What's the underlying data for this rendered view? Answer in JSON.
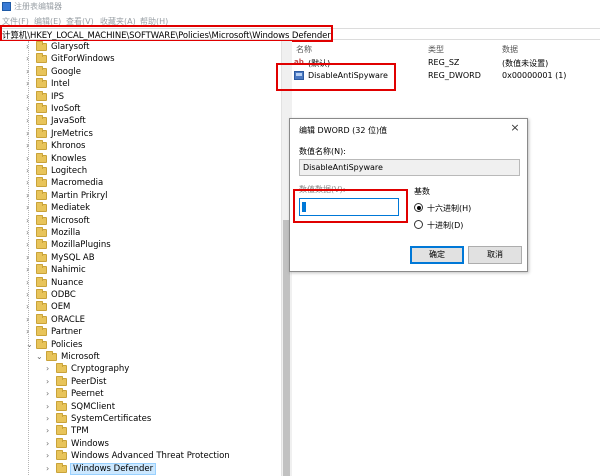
{
  "window": {
    "title": "注册表编辑器"
  },
  "menu": [
    "文件(F)",
    "编辑(E)",
    "查看(V)",
    "收藏夹(A)",
    "帮助(H)"
  ],
  "address": {
    "path": "计算机\\HKEY_LOCAL_MACHINE\\SOFTWARE\\Policies\\Microsoft\\Windows Defender"
  },
  "tree": {
    "items": [
      {
        "label": "Glarysoft",
        "level": 1
      },
      {
        "label": "GitForWindows",
        "level": 1
      },
      {
        "label": "Google",
        "level": 1
      },
      {
        "label": "Intel",
        "level": 1
      },
      {
        "label": "IPS",
        "level": 1
      },
      {
        "label": "IvoSoft",
        "level": 1
      },
      {
        "label": "JavaSoft",
        "level": 1
      },
      {
        "label": "JreMetrics",
        "level": 1
      },
      {
        "label": "Khronos",
        "level": 1
      },
      {
        "label": "Knowles",
        "level": 1
      },
      {
        "label": "Logitech",
        "level": 1
      },
      {
        "label": "Macromedia",
        "level": 1
      },
      {
        "label": "Martin Prikryl",
        "level": 1
      },
      {
        "label": "Mediatek",
        "level": 1
      },
      {
        "label": "Microsoft",
        "level": 1
      },
      {
        "label": "Mozilla",
        "level": 1
      },
      {
        "label": "MozillaPlugins",
        "level": 1
      },
      {
        "label": "MySQL AB",
        "level": 1
      },
      {
        "label": "Nahimic",
        "level": 1
      },
      {
        "label": "Nuance",
        "level": 1
      },
      {
        "label": "ODBC",
        "level": 1
      },
      {
        "label": "OEM",
        "level": 1
      },
      {
        "label": "ORACLE",
        "level": 1
      },
      {
        "label": "Partner",
        "level": 1
      },
      {
        "label": "Policies",
        "level": 1,
        "expanded": true
      },
      {
        "label": "Microsoft",
        "level": 2,
        "expanded": true
      },
      {
        "label": "Cryptography",
        "level": 3
      },
      {
        "label": "PeerDist",
        "level": 3
      },
      {
        "label": "Peernet",
        "level": 3
      },
      {
        "label": "SQMClient",
        "level": 3
      },
      {
        "label": "SystemCertificates",
        "level": 3
      },
      {
        "label": "TPM",
        "level": 3
      },
      {
        "label": "Windows",
        "level": 3
      },
      {
        "label": "Windows Advanced Threat Protection",
        "level": 3
      },
      {
        "label": "Windows Defender",
        "level": 3,
        "selected": true
      }
    ]
  },
  "values": {
    "headers": {
      "name": "名称",
      "type": "类型",
      "data": "数据"
    },
    "rows": [
      {
        "name": "(默认)",
        "type": "REG_SZ",
        "data": "(数值未设置)",
        "icon": "string-value-icon"
      },
      {
        "name": "DisableAntiSpyware",
        "type": "REG_DWORD",
        "data": "0x00000001 (1)",
        "icon": "dword-value-icon"
      }
    ]
  },
  "dialog": {
    "title": "编辑 DWORD (32 位)值",
    "name_label": "数值名称(N):",
    "name_value": "DisableAntiSpyware",
    "data_label": "数值数据(V):",
    "data_value": "1",
    "base_label": "基数",
    "radio_hex": "十六进制(H)",
    "radio_dec": "十进制(D)",
    "selected_base": "hex",
    "ok": "确定",
    "cancel": "取消",
    "close_glyph": "×"
  },
  "colors": {
    "highlight": "#e00000",
    "accent": "#0078d7",
    "folder": "#e8c45a"
  }
}
